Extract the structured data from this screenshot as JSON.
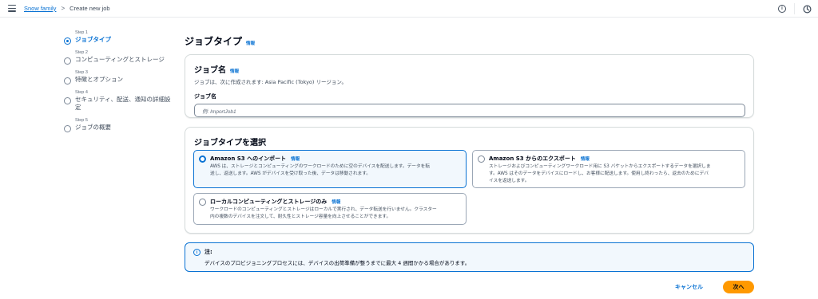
{
  "topbar": {
    "breadcrumb_root": "Snow family",
    "breadcrumb_current": "Create new job",
    "separator": ">",
    "info_icon_glyph": "i",
    "icons": [
      "menu-icon",
      "info-circle-icon",
      "notification-icon"
    ]
  },
  "steps": [
    {
      "num": "Step 1",
      "title": "ジョブタイプ",
      "active": true
    },
    {
      "num": "Step 2",
      "title": "コンピューティングとストレージ",
      "active": false
    },
    {
      "num": "Step 3",
      "title": "特徴とオプション",
      "active": false
    },
    {
      "num": "Step 4",
      "title": "セキュリティ、配送、通知の詳細設定",
      "active": false
    },
    {
      "num": "Step 5",
      "title": "ジョブの概要",
      "active": false
    }
  ],
  "page": {
    "title": "ジョブタイプ",
    "info": "情報"
  },
  "job_name_panel": {
    "title": "ジョブ名",
    "info": "情報",
    "description": "ジョブは、次に作成されます: Asia Pacific (Tokyo) リージョン。",
    "field_label": "ジョブ名",
    "placeholder": "例: ImportJob1"
  },
  "job_type_panel": {
    "title": "ジョブタイプを選択",
    "options": [
      {
        "title": "Amazon S3 へのインポート",
        "info": "情報",
        "desc1": "AWS は、ストレージとコンピューティングのワークロードのために空のデバイスを配送します。データを転",
        "desc2": "送し、返送します。AWS がデバイスを受け取った後、データは移動されます。",
        "selected": true
      },
      {
        "title": "Amazon S3 からのエクスポート",
        "info": "情報",
        "desc1": "ストレージおよびコンピューティングワークロード用に S3 バケットからエクスポートするデータを選択しま",
        "desc2": "す。AWS はそのデータをデバイスにロードし、お客様に配送します。使用し終わったら、返去のためにデバ",
        "desc3": "イスを返送します。",
        "selected": false
      },
      {
        "title": "ローカルコンピューティングとストレージのみ",
        "info": "情報",
        "desc1": "ワークロードのコンピューティングとストレージはローカルで実行され、データ転送を行いません。クラスター",
        "desc2": "内の複数のデバイスを注文して、耐久性とストレージ容量を向上させることができます。",
        "selected": false
      }
    ]
  },
  "alert": {
    "icon_glyph": "i",
    "title": "注:",
    "body": "デバイスのプロビジョニングプロセスには、デバイスの出荷準備が整うまでに最大 4 週間かかる場合があります。"
  },
  "actions": {
    "cancel": "キャンセル",
    "next": "次へ"
  },
  "colors": {
    "accent": "#0972d3",
    "primary_button": "#ff9900",
    "alert_bg": "#f2f8fd"
  }
}
